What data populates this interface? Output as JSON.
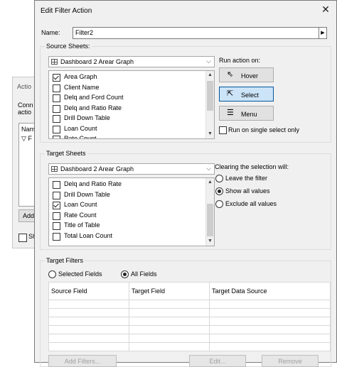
{
  "background_dialog": {
    "title": "Actio",
    "line1": "Conn",
    "line2": "actio",
    "list_header": "Nam",
    "list_row": "F",
    "add_label": "Add",
    "check_label": "Sh"
  },
  "dialog": {
    "title": "Edit Filter Action"
  },
  "name": {
    "label": "Name:",
    "value": "Filter2",
    "button": "▶"
  },
  "source_sheets": {
    "legend": "Source Sheets:",
    "dropdown_value": "Dashboard 2 Arear Graph",
    "items": [
      {
        "label": "Area Graph",
        "checked": true
      },
      {
        "label": "Client Name",
        "checked": false
      },
      {
        "label": "Delq and Ford Count",
        "checked": false
      },
      {
        "label": "Delq and Ratio Rate",
        "checked": false
      },
      {
        "label": "Drill Down Table",
        "checked": false
      },
      {
        "label": "Loan Count",
        "checked": false
      },
      {
        "label": "Rate Count",
        "checked": false
      }
    ],
    "run_action_label": "Run action on:",
    "actions": [
      {
        "label": "Hover",
        "icon": "pointer-icon",
        "selected": false
      },
      {
        "label": "Select",
        "icon": "click-icon",
        "selected": true
      },
      {
        "label": "Menu",
        "icon": "menu-icon",
        "selected": false
      }
    ],
    "single_select_label": "Run on single select only",
    "single_select_checked": false
  },
  "target_sheets": {
    "legend": "Target Sheets",
    "dropdown_value": "Dashboard 2 Arear Graph",
    "items": [
      {
        "label": "Delq and Ratio Rate",
        "checked": false
      },
      {
        "label": "Drill Down Table",
        "checked": false
      },
      {
        "label": "Loan Count",
        "checked": true
      },
      {
        "label": "Rate Count",
        "checked": false
      },
      {
        "label": "Title of Table",
        "checked": false
      },
      {
        "label": "Total Loan Count",
        "checked": false
      }
    ],
    "clearing_label": "Clearing the selection will:",
    "clearing_options": [
      {
        "label": "Leave the filter",
        "selected": false
      },
      {
        "label": "Show all values",
        "selected": true
      },
      {
        "label": "Exclude all values",
        "selected": false
      }
    ]
  },
  "target_filters": {
    "legend": "Target Filters",
    "options": [
      {
        "label": "Selected Fields",
        "selected": false
      },
      {
        "label": "All Fields",
        "selected": true
      }
    ],
    "columns": [
      "Source Field",
      "Target Field",
      "Target Data Source"
    ],
    "rows": [
      [
        "",
        "",
        ""
      ],
      [
        "",
        "",
        ""
      ],
      [
        "",
        "",
        ""
      ],
      [
        "",
        "",
        ""
      ],
      [
        "",
        "",
        ""
      ],
      [
        "",
        "",
        ""
      ]
    ],
    "buttons": {
      "add": "Add Filters...",
      "edit": "Edit...",
      "remove": "Remove"
    }
  },
  "colors": {
    "dialog_bg": "#f0f0f0",
    "selected_button": "#cce4f7",
    "selected_border": "#005499"
  }
}
